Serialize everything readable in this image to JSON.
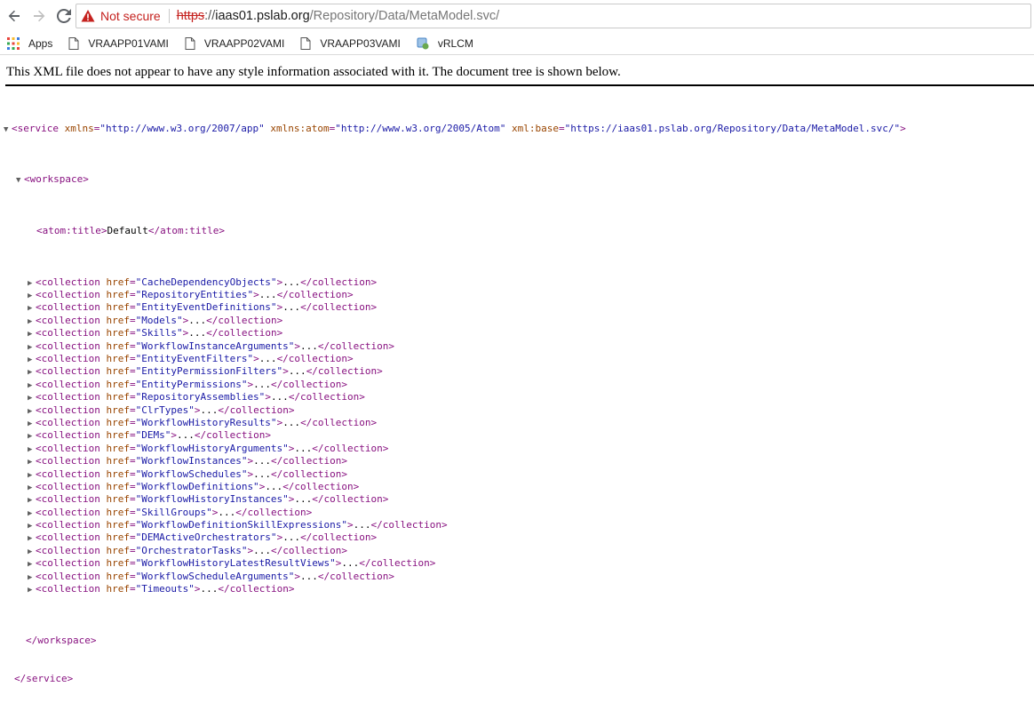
{
  "browser": {
    "security_label": "Not secure",
    "url_scheme": "https",
    "url_sep": "://",
    "url_host": "iaas01.pslab.org",
    "url_path": "/Repository/Data/MetaModel.svc/"
  },
  "bookmarks": [
    {
      "label": "Apps",
      "icon": "apps-grid-icon"
    },
    {
      "label": "VRAAPP01VAMI",
      "icon": "page-icon"
    },
    {
      "label": "VRAAPP02VAMI",
      "icon": "page-icon"
    },
    {
      "label": "VRAAPP03VAMI",
      "icon": "page-icon"
    },
    {
      "label": "vRLCM",
      "icon": "vrlcm-icon"
    }
  ],
  "info_text": "This XML file does not appear to have any style information associated with it. The document tree is shown below.",
  "xml": {
    "service_open": "<service",
    "service_attrs": [
      {
        "name": "xmlns",
        "value": "\"http://www.w3.org/2007/app\""
      },
      {
        "name": "xmlns:atom",
        "value": "\"http://www.w3.org/2005/Atom\""
      },
      {
        "name": "xml:base",
        "value": "\"https://iaas01.pslab.org/Repository/Data/MetaModel.svc/\""
      }
    ],
    "workspace_open": "<workspace>",
    "atom_title_open": "<atom:title>",
    "atom_title_text": "Default",
    "atom_title_close": "</atom:title>",
    "collection_open": "<collection",
    "collection_attr": "href",
    "collection_ellipsis": "...",
    "collection_close": "</collection>",
    "collections": [
      "\"CacheDependencyObjects\"",
      "\"RepositoryEntities\"",
      "\"EntityEventDefinitions\"",
      "\"Models\"",
      "\"Skills\"",
      "\"WorkflowInstanceArguments\"",
      "\"EntityEventFilters\"",
      "\"EntityPermissionFilters\"",
      "\"EntityPermissions\"",
      "\"RepositoryAssemblies\"",
      "\"ClrTypes\"",
      "\"WorkflowHistoryResults\"",
      "\"DEMs\"",
      "\"WorkflowHistoryArguments\"",
      "\"WorkflowInstances\"",
      "\"WorkflowSchedules\"",
      "\"WorkflowDefinitions\"",
      "\"WorkflowHistoryInstances\"",
      "\"SkillGroups\"",
      "\"WorkflowDefinitionSkillExpressions\"",
      "\"DEMActiveOrchestrators\"",
      "\"OrchestratorTasks\"",
      "\"WorkflowHistoryLatestResultViews\"",
      "\"WorkflowScheduleArguments\"",
      "\"Timeouts\""
    ],
    "workspace_close": "</workspace>",
    "service_close": "</service>"
  }
}
